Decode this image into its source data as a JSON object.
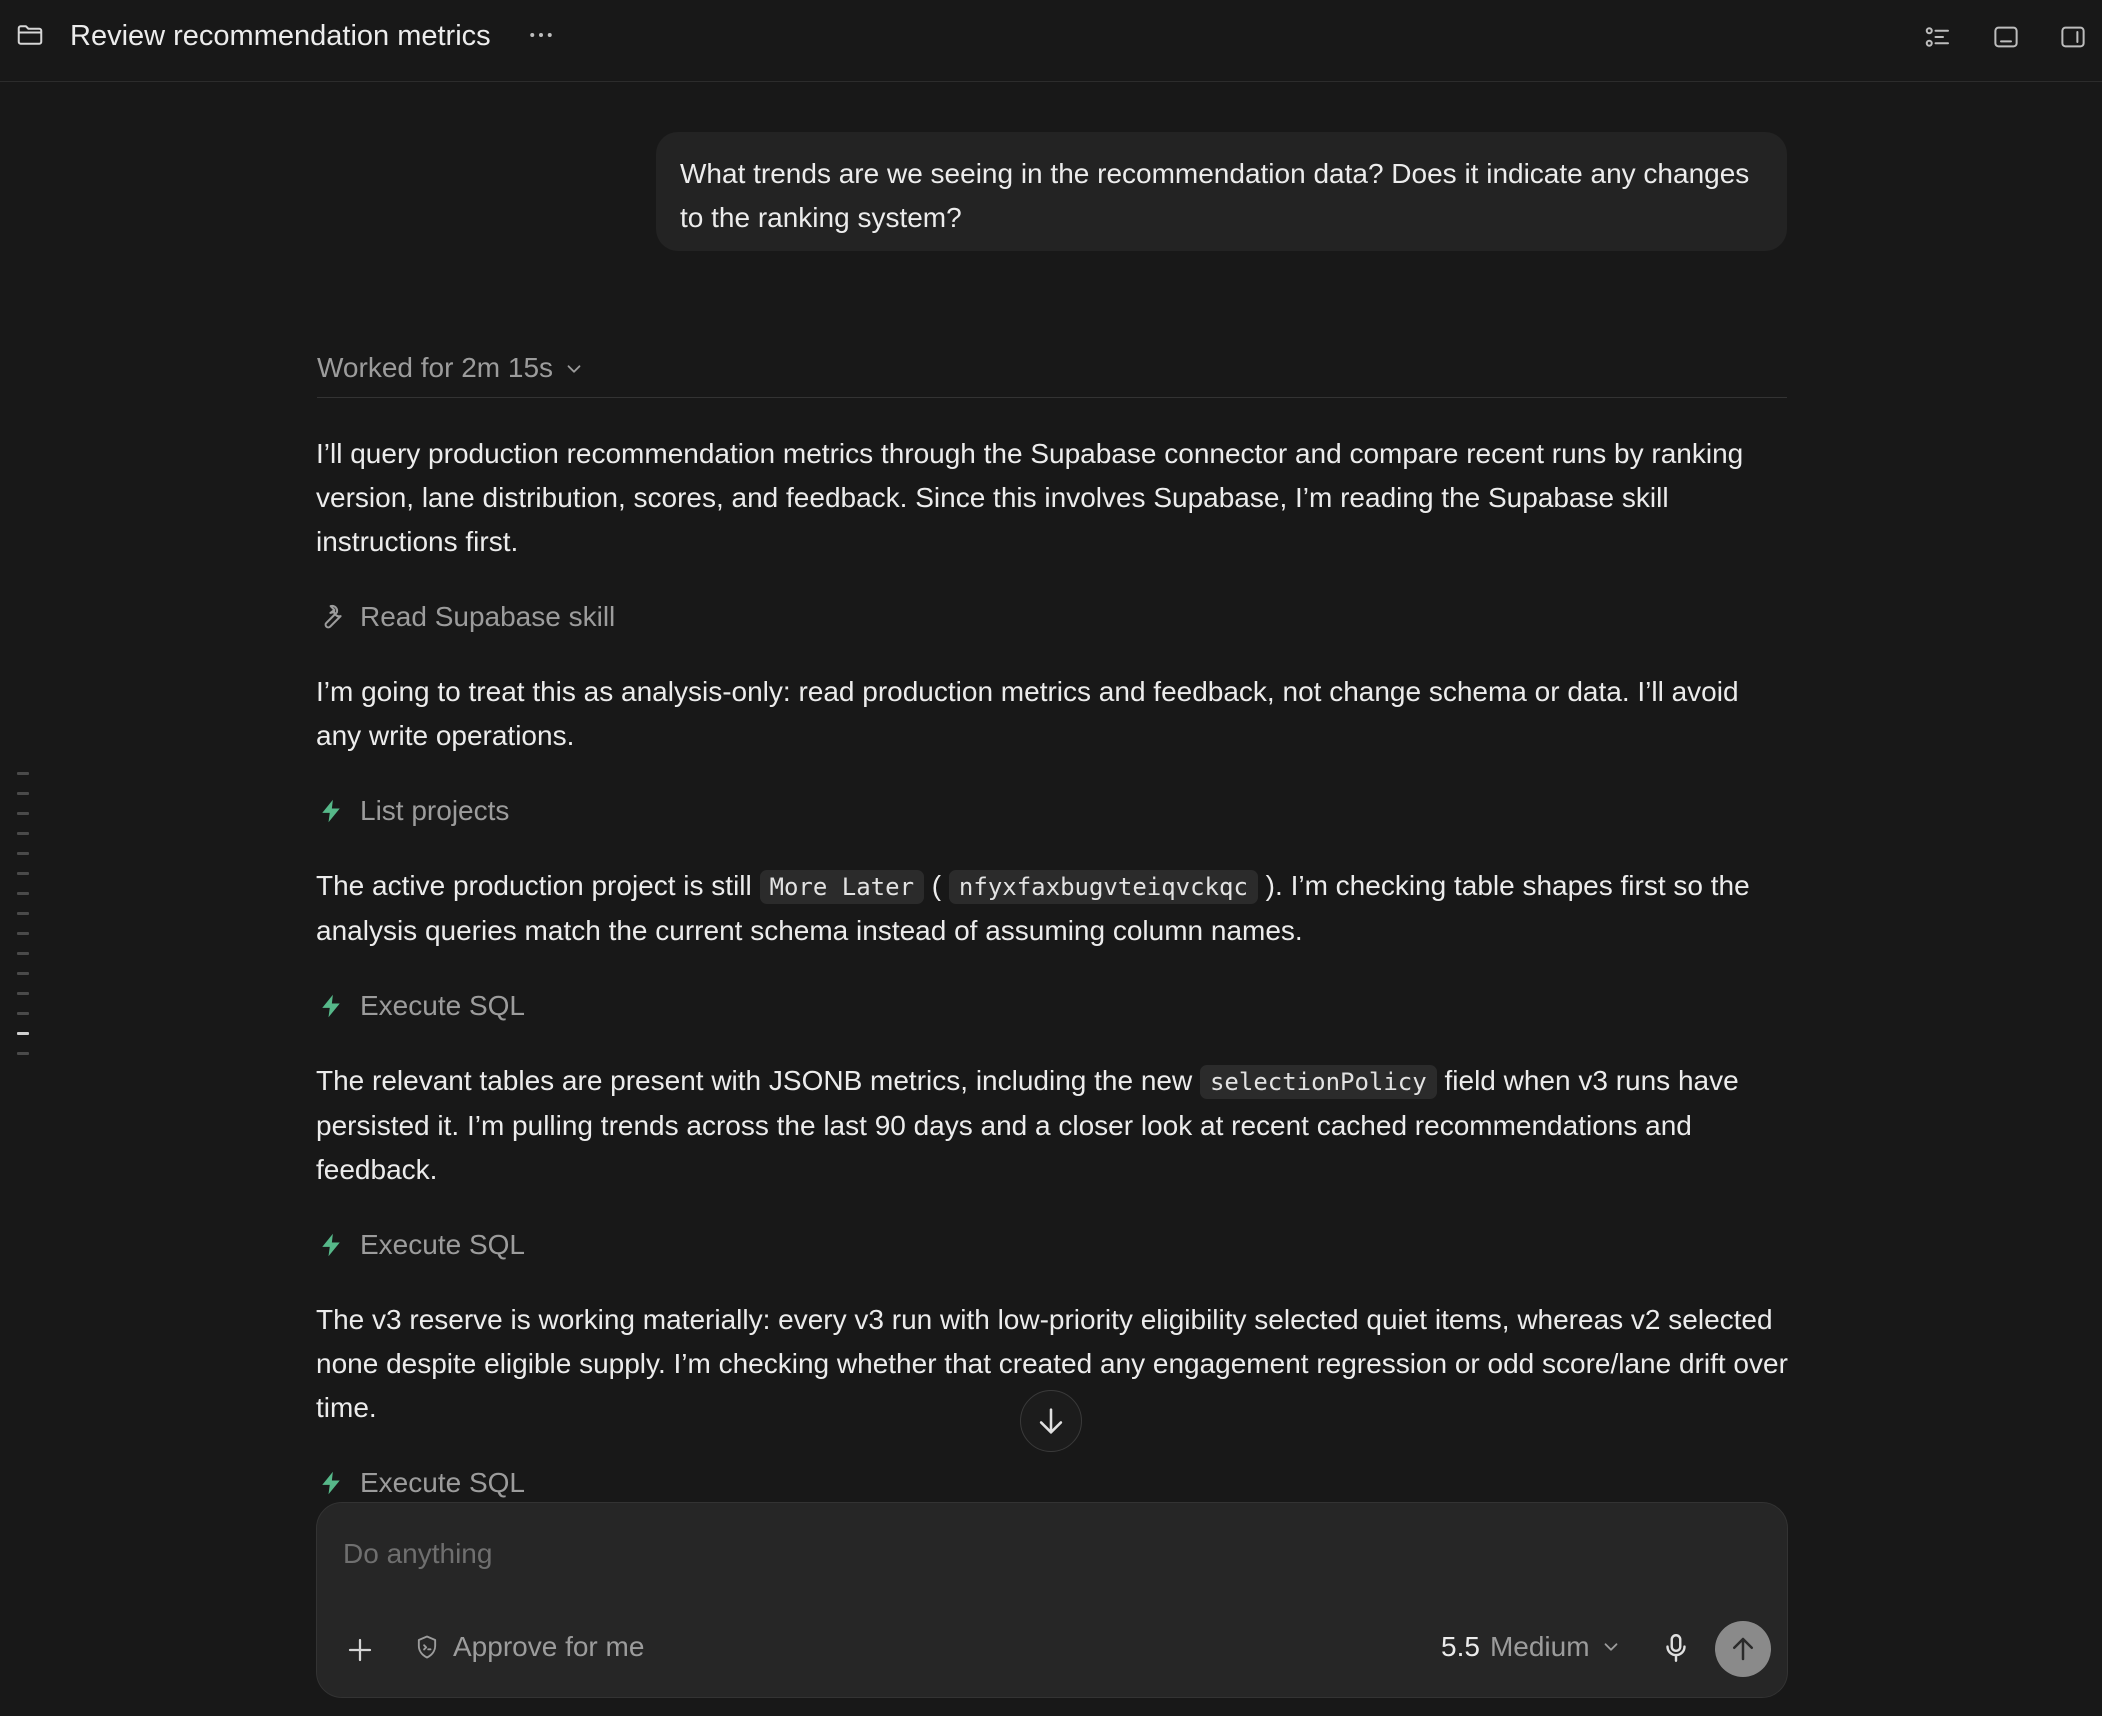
{
  "header": {
    "title": "Review recommendation metrics",
    "icons": [
      "folder-icon",
      "more-icon",
      "task-list-icon",
      "bottom-panel-icon",
      "side-panel-icon"
    ]
  },
  "user_message": "What trends are we seeing in the recommendation data? Does it indicate any changes to the ranking system?",
  "worked_for": "Worked for 2m 15s",
  "messages": {
    "p1": "I’ll query production recommendation metrics through the Supabase connector and compare recent runs by ranking version, lane distribution, scores, and feedback. Since this involves Supabase, I’m reading the Supabase skill instructions first.",
    "tool1": "Read Supabase skill",
    "p2": "I’m going to treat this as analysis-only: read production metrics and feedback, not change schema or data. I’ll avoid any write operations.",
    "tool2": "List projects",
    "p3_a": "The active production project is still ",
    "p3_code1": "More Later",
    "p3_b": " ( ",
    "p3_code2": "nfyxfaxbugvteiqvckqc",
    "p3_c": " ). I’m checking table shapes first so the analysis queries match the current schema instead of assuming column names.",
    "tool3": "Execute SQL",
    "p4_a": "The relevant tables are present with JSONB metrics, including the new ",
    "p4_code": "selectionPolicy",
    "p4_b": " field when v3 runs have persisted it. I’m pulling trends across the last 90 days and a closer look at recent cached recommendations and feedback.",
    "tool4": "Execute SQL",
    "p5": "The v3 reserve is working materially: every v3 run with low-priority eligibility selected quiet items, whereas v2 selected none despite eligible supply. I’m checking whether that created any engagement regression or odd score/lane drift over time.",
    "tool5": "Execute SQL"
  },
  "composer": {
    "placeholder": "Do anything",
    "approve_label": "Approve for me",
    "model_version": "5.5",
    "model_effort": "Medium"
  },
  "colors": {
    "background": "#181818",
    "accent": "#56b889",
    "bubble": "#232323"
  }
}
